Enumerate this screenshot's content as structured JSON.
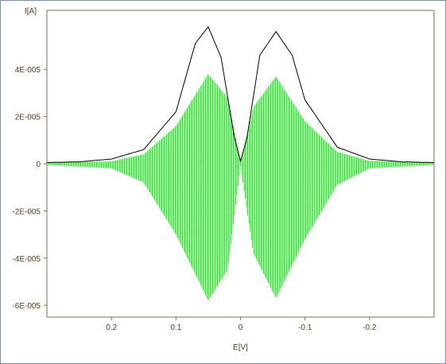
{
  "chart_data": {
    "type": "line",
    "title": "",
    "xlabel": "E[V]",
    "ylabel": "I[A]",
    "xlim": [
      0.3,
      -0.3
    ],
    "ylim": [
      -6.5e-05,
      6.5e-05
    ],
    "x_ticks": [
      0.2,
      0.1,
      0,
      -0.1,
      -0.2
    ],
    "x_tick_labels": [
      "0.2",
      "0.1",
      "0",
      "-0.1",
      "-0.2"
    ],
    "y_ticks": [
      4e-05,
      2e-05,
      0,
      -2e-05,
      -4e-05,
      -6e-05
    ],
    "y_tick_labels": [
      "4E-005",
      "2E-005",
      "0",
      "-2E-005",
      "-4E-005",
      "-6E-005"
    ],
    "grid": false,
    "series": [
      {
        "color": "#00dd00",
        "description_points": {
          "x": [
            0.3,
            0.2,
            0.15,
            0.1,
            0.05,
            0.02,
            0,
            -0.02,
            -0.055,
            -0.1,
            -0.15,
            -0.2,
            -0.3
          ],
          "y_upper": [
            5e-07,
            1e-06,
            4e-06,
            1.6e-05,
            3.8e-05,
            2.8e-05,
            3e-07,
            2.4e-05,
            3.7e-05,
            1.8e-05,
            5e-06,
            1.2e-06,
            5e-07
          ],
          "y_lower": [
            -5e-07,
            -2e-06,
            -8e-06,
            -3e-05,
            -5.8e-05,
            -4.5e-05,
            -1e-06,
            -3.8e-05,
            -5.7e-05,
            -3.2e-05,
            -9e-06,
            -2e-06,
            -5e-07
          ]
        }
      },
      {
        "color": "#000000",
        "description_points": {
          "x": [
            0.3,
            0.25,
            0.2,
            0.15,
            0.1,
            0.07,
            0.05,
            0.03,
            0.01,
            0,
            -0.01,
            -0.03,
            -0.055,
            -0.08,
            -0.1,
            -0.15,
            -0.2,
            -0.25,
            -0.3
          ],
          "y": [
            5e-07,
            8e-07,
            2e-06,
            6e-06,
            2.2e-05,
            5.1e-05,
            5.8e-05,
            4.5e-05,
            1.2e-05,
            1e-06,
            1.1e-05,
            4.6e-05,
            5.6e-05,
            4.6e-05,
            2.7e-05,
            7e-06,
            2e-06,
            8e-07,
            5e-07
          ]
        }
      }
    ]
  }
}
